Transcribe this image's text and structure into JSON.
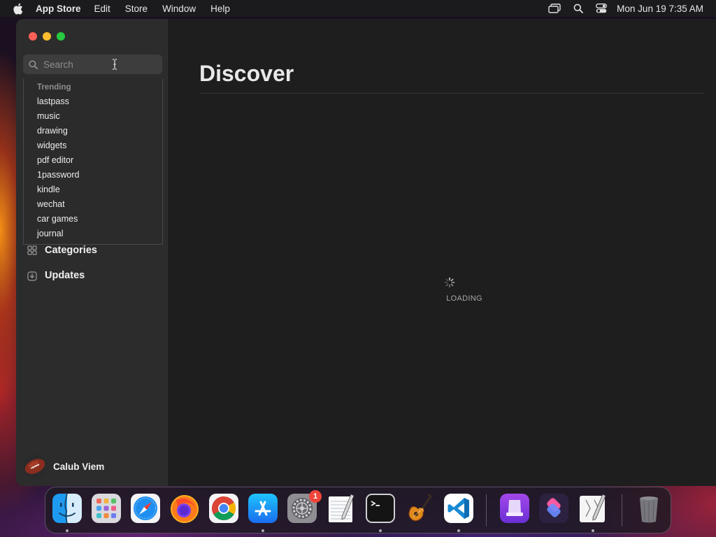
{
  "menubar": {
    "apple_icon": "apple-logo",
    "app_name": "App Store",
    "items": [
      "Edit",
      "Store",
      "Window",
      "Help"
    ],
    "status_icons": [
      "screen-mirroring-icon",
      "spotlight-search-icon",
      "control-center-icon"
    ],
    "clock": "Mon Jun 19  7:35 AM"
  },
  "window": {
    "traffic_lights": [
      "close",
      "minimize",
      "zoom"
    ],
    "search": {
      "placeholder": "Search",
      "value": ""
    },
    "suggestions": {
      "heading": "Trending",
      "items": [
        "lastpass",
        "music",
        "drawing",
        "widgets",
        "pdf editor",
        "1password",
        "kindle",
        "wechat",
        "car games",
        "journal"
      ]
    },
    "nav": [
      {
        "label": "Categories",
        "icon": "categories-grid-icon"
      },
      {
        "label": "Updates",
        "icon": "updates-download-icon"
      }
    ],
    "profile": {
      "name": "Calub Viem",
      "avatar_icon": "football-avatar"
    },
    "main": {
      "title": "Discover",
      "loading_text": "LOADING"
    }
  },
  "dock": {
    "apps": [
      {
        "name": "Finder",
        "icon": "finder-icon",
        "running": true
      },
      {
        "name": "Launchpad",
        "icon": "launchpad-icon",
        "running": false
      },
      {
        "name": "Safari",
        "icon": "safari-icon",
        "running": false
      },
      {
        "name": "Firefox",
        "icon": "firefox-icon",
        "running": false
      },
      {
        "name": "Chrome",
        "icon": "chrome-icon",
        "running": false
      },
      {
        "name": "App Store",
        "icon": "app-store-icon",
        "running": true
      },
      {
        "name": "System Settings",
        "icon": "system-settings-icon",
        "running": false,
        "badge": "1"
      },
      {
        "name": "TextEdit",
        "icon": "textedit-icon",
        "running": false
      },
      {
        "name": "Terminal",
        "icon": "terminal-icon",
        "running": true
      },
      {
        "name": "GarageBand",
        "icon": "garageband-icon",
        "running": false
      },
      {
        "name": "Visual Studio Code",
        "icon": "vscode-icon",
        "running": true
      },
      {
        "name": "Apple Configurator",
        "icon": "configurator-icon",
        "running": false
      },
      {
        "name": "Shortcuts",
        "icon": "shortcuts-icon",
        "running": false
      },
      {
        "name": "Script Editor",
        "icon": "script-editor-icon",
        "running": true
      },
      {
        "name": "Trash",
        "icon": "trash-icon",
        "running": false
      }
    ]
  }
}
